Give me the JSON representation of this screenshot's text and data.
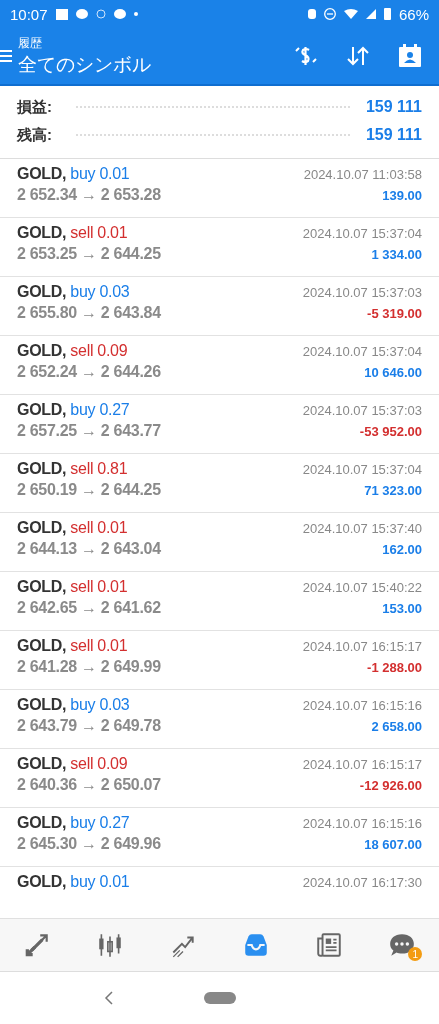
{
  "status_bar": {
    "time": "10:07",
    "battery": "66%"
  },
  "header": {
    "subtitle": "履歴",
    "title": "全てのシンボル"
  },
  "summary": [
    {
      "label": "損益:",
      "value": "159 111"
    },
    {
      "label": "残高:",
      "value": "159 111"
    }
  ],
  "deals": [
    {
      "symbol": "GOLD,",
      "side": "buy",
      "volume": "0.01",
      "prices": "2 652.34 → 2 653.28",
      "time": "2024.10.07 11:03:58",
      "profit": "139.00",
      "negative": false
    },
    {
      "symbol": "GOLD,",
      "side": "sell",
      "volume": "0.01",
      "prices": "2 653.25 → 2 644.25",
      "time": "2024.10.07 15:37:04",
      "profit": "1 334.00",
      "negative": false
    },
    {
      "symbol": "GOLD,",
      "side": "buy",
      "volume": "0.03",
      "prices": "2 655.80 → 2 643.84",
      "time": "2024.10.07 15:37:03",
      "profit": "-5 319.00",
      "negative": true
    },
    {
      "symbol": "GOLD,",
      "side": "sell",
      "volume": "0.09",
      "prices": "2 652.24 → 2 644.26",
      "time": "2024.10.07 15:37:04",
      "profit": "10 646.00",
      "negative": false
    },
    {
      "symbol": "GOLD,",
      "side": "buy",
      "volume": "0.27",
      "prices": "2 657.25 → 2 643.77",
      "time": "2024.10.07 15:37:03",
      "profit": "-53 952.00",
      "negative": true
    },
    {
      "symbol": "GOLD,",
      "side": "sell",
      "volume": "0.81",
      "prices": "2 650.19 → 2 644.25",
      "time": "2024.10.07 15:37:04",
      "profit": "71 323.00",
      "negative": false
    },
    {
      "symbol": "GOLD,",
      "side": "sell",
      "volume": "0.01",
      "prices": "2 644.13 → 2 643.04",
      "time": "2024.10.07 15:37:40",
      "profit": "162.00",
      "negative": false
    },
    {
      "symbol": "GOLD,",
      "side": "sell",
      "volume": "0.01",
      "prices": "2 642.65 → 2 641.62",
      "time": "2024.10.07 15:40:22",
      "profit": "153.00",
      "negative": false
    },
    {
      "symbol": "GOLD,",
      "side": "sell",
      "volume": "0.01",
      "prices": "2 641.28 → 2 649.99",
      "time": "2024.10.07 16:15:17",
      "profit": "-1 288.00",
      "negative": true
    },
    {
      "symbol": "GOLD,",
      "side": "buy",
      "volume": "0.03",
      "prices": "2 643.79 → 2 649.78",
      "time": "2024.10.07 16:15:16",
      "profit": "2 658.00",
      "negative": false
    },
    {
      "symbol": "GOLD,",
      "side": "sell",
      "volume": "0.09",
      "prices": "2 640.36 → 2 650.07",
      "time": "2024.10.07 16:15:17",
      "profit": "-12 926.00",
      "negative": true
    },
    {
      "symbol": "GOLD,",
      "side": "buy",
      "volume": "0.27",
      "prices": "2 645.30 → 2 649.96",
      "time": "2024.10.07 16:15:16",
      "profit": "18 607.00",
      "negative": false
    },
    {
      "symbol": "GOLD,",
      "side": "buy",
      "volume": "0.01",
      "time": "2024.10.07 16:17:30"
    }
  ],
  "bottom_nav": [
    {
      "kind": "quotes",
      "selected": false
    },
    {
      "kind": "chart",
      "selected": false
    },
    {
      "kind": "trade",
      "selected": false
    },
    {
      "kind": "history",
      "selected": true
    },
    {
      "kind": "news",
      "selected": false
    },
    {
      "kind": "chat",
      "selected": false,
      "badge": "1"
    }
  ]
}
